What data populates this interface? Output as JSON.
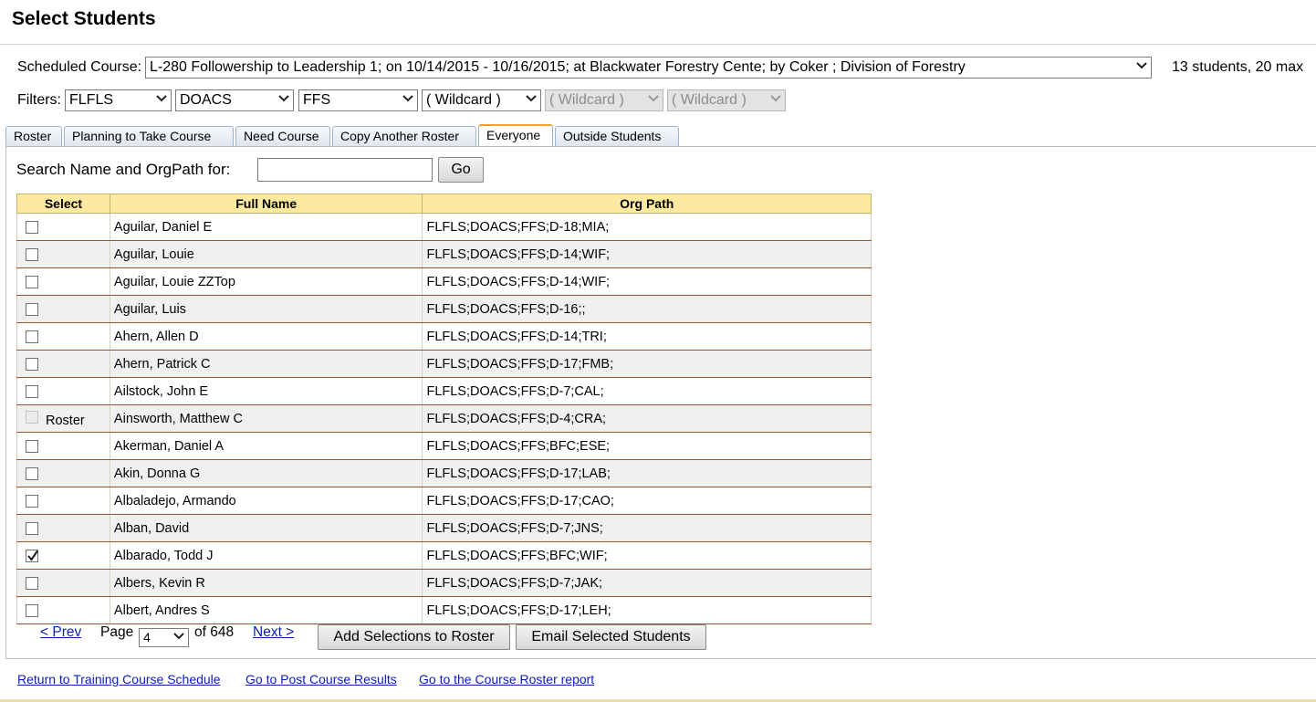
{
  "page": {
    "title": "Select Students"
  },
  "course": {
    "label": "Scheduled Course:",
    "selected": "L-280 Followership to Leadership 1; on 10/14/2015 - 10/16/2015; at Blackwater Forestry Cente; by Coker ; Division of Forestry",
    "capacity": "13 students, 20 max"
  },
  "filters": {
    "label": "Filters:",
    "items": [
      {
        "value": "FLFLS",
        "disabled": false
      },
      {
        "value": "DOACS",
        "disabled": false
      },
      {
        "value": "FFS",
        "disabled": false
      },
      {
        "value": "( Wildcard )",
        "disabled": false
      },
      {
        "value": "( Wildcard )",
        "disabled": true
      },
      {
        "value": "( Wildcard )",
        "disabled": true
      }
    ]
  },
  "tabs": [
    {
      "label": "Roster",
      "active": false
    },
    {
      "label": "Planning to Take Course",
      "active": false
    },
    {
      "label": "Need Course",
      "active": false
    },
    {
      "label": "Copy Another Roster",
      "active": false
    },
    {
      "label": "Everyone",
      "active": true
    },
    {
      "label": "Outside Students",
      "active": false
    }
  ],
  "search": {
    "label": "Search Name and OrgPath for:",
    "value": "",
    "button": "Go"
  },
  "table": {
    "headers": [
      "Select",
      "Full Name",
      "Org Path"
    ],
    "rows": [
      {
        "checked": false,
        "disabled": false,
        "tag": "",
        "name": "Aguilar, Daniel E",
        "org": "FLFLS;DOACS;FFS;D-18;MIA;"
      },
      {
        "checked": false,
        "disabled": false,
        "tag": "",
        "name": "Aguilar, Louie",
        "org": "FLFLS;DOACS;FFS;D-14;WIF;"
      },
      {
        "checked": false,
        "disabled": false,
        "tag": "",
        "name": "Aguilar, Louie ZZTop",
        "org": "FLFLS;DOACS;FFS;D-14;WIF;"
      },
      {
        "checked": false,
        "disabled": false,
        "tag": "",
        "name": "Aguilar, Luis",
        "org": "FLFLS;DOACS;FFS;D-16;;"
      },
      {
        "checked": false,
        "disabled": false,
        "tag": "",
        "name": "Ahern, Allen D",
        "org": "FLFLS;DOACS;FFS;D-14;TRI;"
      },
      {
        "checked": false,
        "disabled": false,
        "tag": "",
        "name": "Ahern, Patrick C",
        "org": "FLFLS;DOACS;FFS;D-17;FMB;"
      },
      {
        "checked": false,
        "disabled": false,
        "tag": "",
        "name": "Ailstock, John E",
        "org": "FLFLS;DOACS;FFS;D-7;CAL;"
      },
      {
        "checked": false,
        "disabled": true,
        "tag": "Roster",
        "name": "Ainsworth, Matthew C",
        "org": "FLFLS;DOACS;FFS;D-4;CRA;"
      },
      {
        "checked": false,
        "disabled": false,
        "tag": "",
        "name": "Akerman, Daniel A",
        "org": "FLFLS;DOACS;FFS;BFC;ESE;"
      },
      {
        "checked": false,
        "disabled": false,
        "tag": "",
        "name": "Akin, Donna G",
        "org": "FLFLS;DOACS;FFS;D-17;LAB;"
      },
      {
        "checked": false,
        "disabled": false,
        "tag": "",
        "name": "Albaladejo, Armando",
        "org": "FLFLS;DOACS;FFS;D-17;CAO;"
      },
      {
        "checked": false,
        "disabled": false,
        "tag": "",
        "name": "Alban, David",
        "org": "FLFLS;DOACS;FFS;D-7;JNS;"
      },
      {
        "checked": true,
        "disabled": false,
        "tag": "",
        "name": "Albarado, Todd J",
        "org": "FLFLS;DOACS;FFS;BFC;WIF;"
      },
      {
        "checked": false,
        "disabled": false,
        "tag": "",
        "name": "Albers, Kevin R",
        "org": "FLFLS;DOACS;FFS;D-7;JAK;"
      },
      {
        "checked": false,
        "disabled": false,
        "tag": "",
        "name": "Albert, Andres S",
        "org": "FLFLS;DOACS;FFS;D-17;LEH;"
      }
    ]
  },
  "pager": {
    "prev": "< Prev",
    "page_label": "Page",
    "page_value": "4",
    "of_text": "of 648",
    "next": "Next >"
  },
  "actions": {
    "add": "Add Selections to Roster",
    "email": "Email Selected Students"
  },
  "footer": {
    "links": [
      "Return to Training Course Schedule",
      "Go to Post Course Results",
      "Go to the Course Roster report"
    ]
  },
  "icons": {
    "dropdown": "chevron-down-icon",
    "check": "checkmark-icon"
  },
  "colors": {
    "header_bg": "#fde9a0",
    "link": "#0b1fb5",
    "row_border": "#a0522d",
    "active_tab_accent": "#f0a030"
  }
}
